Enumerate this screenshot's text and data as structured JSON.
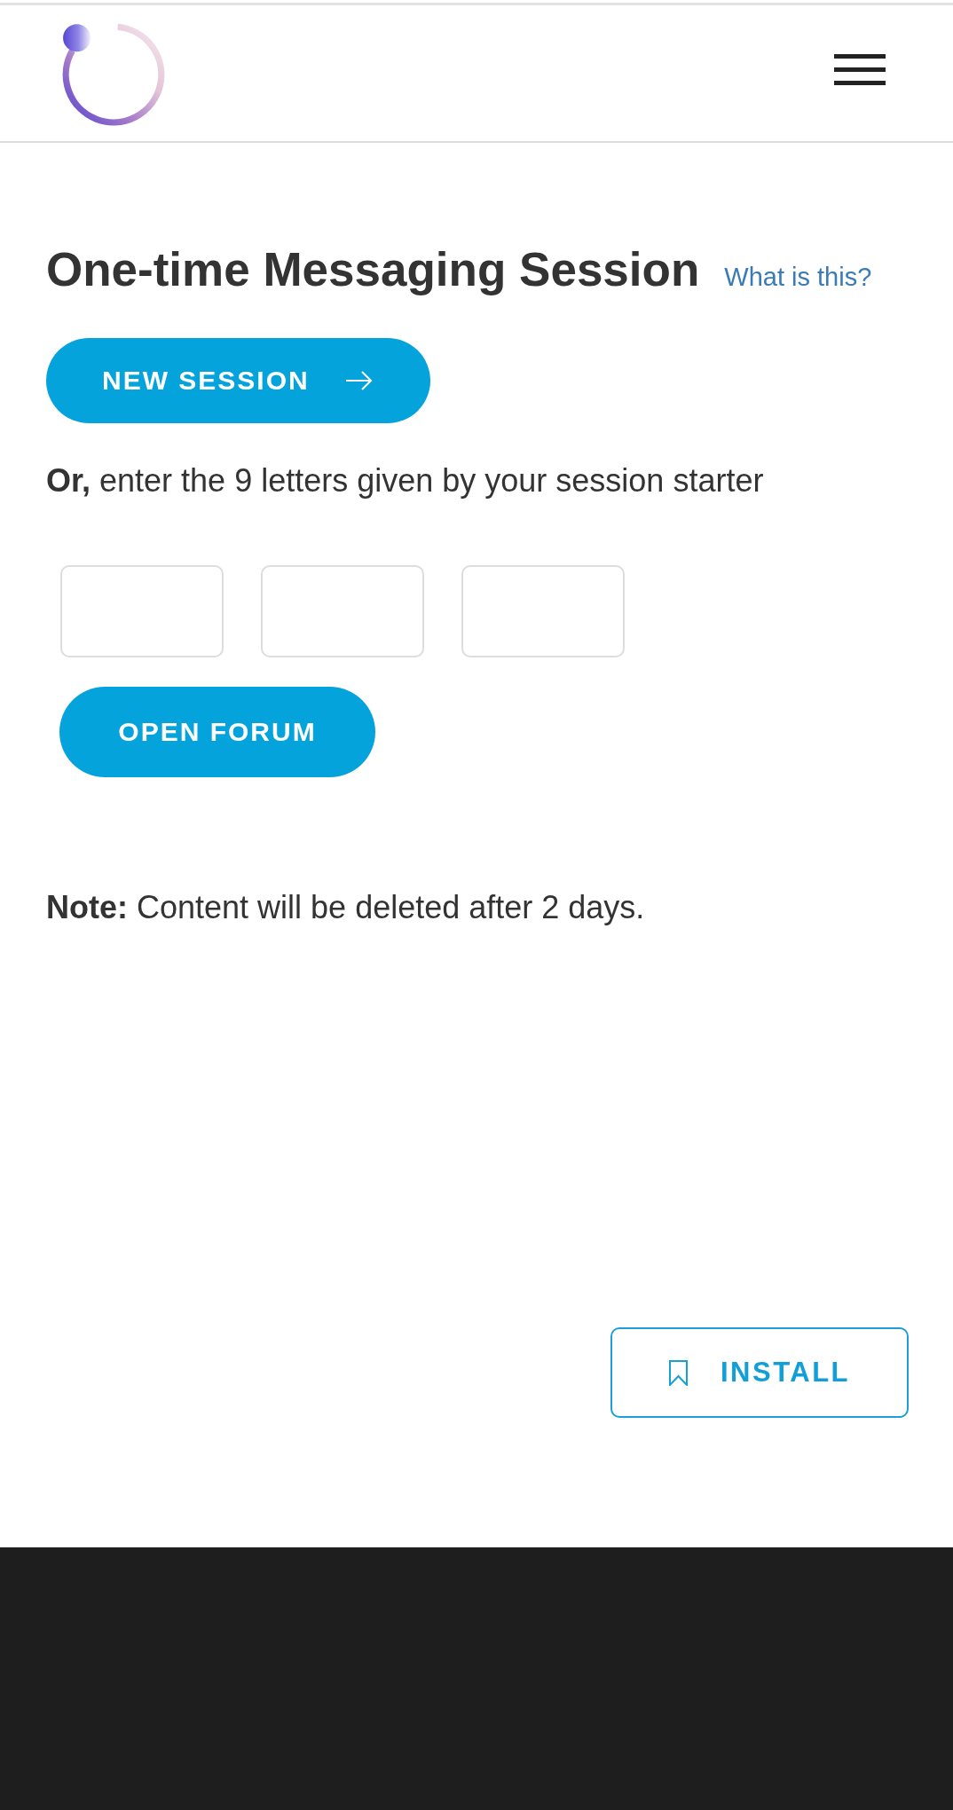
{
  "title": "One-time Messaging Session",
  "help_link": "What is this?",
  "new_session_button": "NEW SESSION",
  "instruction": "**Or,** enter the 9 letters given by your session starter",
  "code_fields": [
    {
      "kind": "input"
    },
    {
      "kind": "input"
    },
    {
      "kind": "input"
    }
  ],
  "open_forum_button": "OPEN FORUM",
  "note": "**Note:** Content will be deleted after 2 days.",
  "install_button": "INSTALL"
}
